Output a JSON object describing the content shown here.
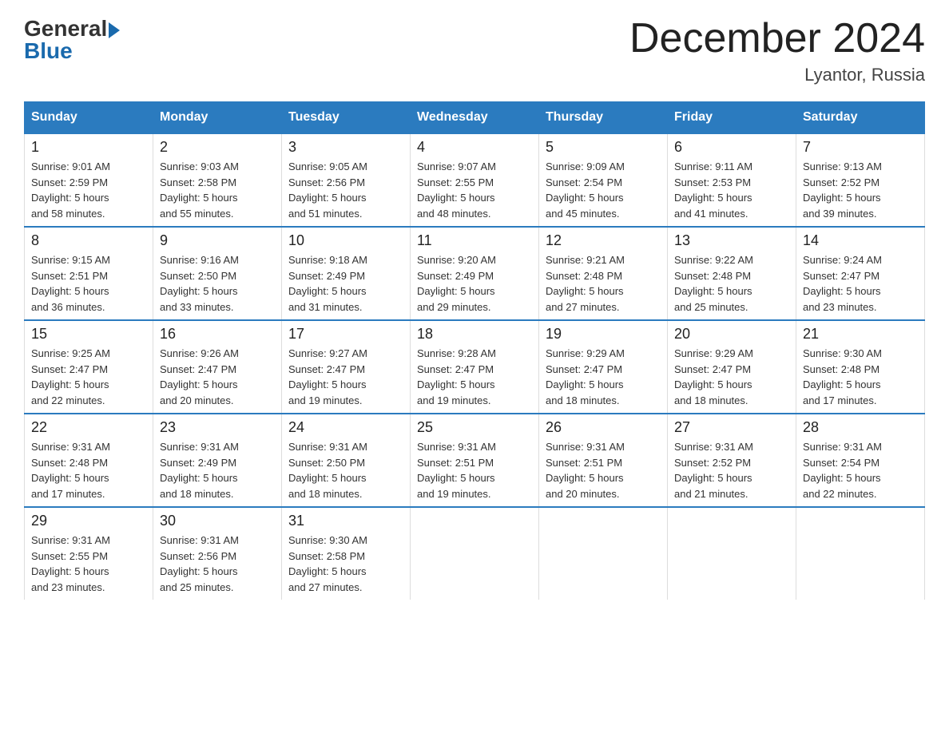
{
  "logo": {
    "general": "General",
    "blue": "Blue"
  },
  "title": "December 2024",
  "location": "Lyantor, Russia",
  "days_of_week": [
    "Sunday",
    "Monday",
    "Tuesday",
    "Wednesday",
    "Thursday",
    "Friday",
    "Saturday"
  ],
  "weeks": [
    [
      {
        "day": "1",
        "sunrise": "Sunrise: 9:01 AM",
        "sunset": "Sunset: 2:59 PM",
        "daylight": "Daylight: 5 hours",
        "daylight2": "and 58 minutes."
      },
      {
        "day": "2",
        "sunrise": "Sunrise: 9:03 AM",
        "sunset": "Sunset: 2:58 PM",
        "daylight": "Daylight: 5 hours",
        "daylight2": "and 55 minutes."
      },
      {
        "day": "3",
        "sunrise": "Sunrise: 9:05 AM",
        "sunset": "Sunset: 2:56 PM",
        "daylight": "Daylight: 5 hours",
        "daylight2": "and 51 minutes."
      },
      {
        "day": "4",
        "sunrise": "Sunrise: 9:07 AM",
        "sunset": "Sunset: 2:55 PM",
        "daylight": "Daylight: 5 hours",
        "daylight2": "and 48 minutes."
      },
      {
        "day": "5",
        "sunrise": "Sunrise: 9:09 AM",
        "sunset": "Sunset: 2:54 PM",
        "daylight": "Daylight: 5 hours",
        "daylight2": "and 45 minutes."
      },
      {
        "day": "6",
        "sunrise": "Sunrise: 9:11 AM",
        "sunset": "Sunset: 2:53 PM",
        "daylight": "Daylight: 5 hours",
        "daylight2": "and 41 minutes."
      },
      {
        "day": "7",
        "sunrise": "Sunrise: 9:13 AM",
        "sunset": "Sunset: 2:52 PM",
        "daylight": "Daylight: 5 hours",
        "daylight2": "and 39 minutes."
      }
    ],
    [
      {
        "day": "8",
        "sunrise": "Sunrise: 9:15 AM",
        "sunset": "Sunset: 2:51 PM",
        "daylight": "Daylight: 5 hours",
        "daylight2": "and 36 minutes."
      },
      {
        "day": "9",
        "sunrise": "Sunrise: 9:16 AM",
        "sunset": "Sunset: 2:50 PM",
        "daylight": "Daylight: 5 hours",
        "daylight2": "and 33 minutes."
      },
      {
        "day": "10",
        "sunrise": "Sunrise: 9:18 AM",
        "sunset": "Sunset: 2:49 PM",
        "daylight": "Daylight: 5 hours",
        "daylight2": "and 31 minutes."
      },
      {
        "day": "11",
        "sunrise": "Sunrise: 9:20 AM",
        "sunset": "Sunset: 2:49 PM",
        "daylight": "Daylight: 5 hours",
        "daylight2": "and 29 minutes."
      },
      {
        "day": "12",
        "sunrise": "Sunrise: 9:21 AM",
        "sunset": "Sunset: 2:48 PM",
        "daylight": "Daylight: 5 hours",
        "daylight2": "and 27 minutes."
      },
      {
        "day": "13",
        "sunrise": "Sunrise: 9:22 AM",
        "sunset": "Sunset: 2:48 PM",
        "daylight": "Daylight: 5 hours",
        "daylight2": "and 25 minutes."
      },
      {
        "day": "14",
        "sunrise": "Sunrise: 9:24 AM",
        "sunset": "Sunset: 2:47 PM",
        "daylight": "Daylight: 5 hours",
        "daylight2": "and 23 minutes."
      }
    ],
    [
      {
        "day": "15",
        "sunrise": "Sunrise: 9:25 AM",
        "sunset": "Sunset: 2:47 PM",
        "daylight": "Daylight: 5 hours",
        "daylight2": "and 22 minutes."
      },
      {
        "day": "16",
        "sunrise": "Sunrise: 9:26 AM",
        "sunset": "Sunset: 2:47 PM",
        "daylight": "Daylight: 5 hours",
        "daylight2": "and 20 minutes."
      },
      {
        "day": "17",
        "sunrise": "Sunrise: 9:27 AM",
        "sunset": "Sunset: 2:47 PM",
        "daylight": "Daylight: 5 hours",
        "daylight2": "and 19 minutes."
      },
      {
        "day": "18",
        "sunrise": "Sunrise: 9:28 AM",
        "sunset": "Sunset: 2:47 PM",
        "daylight": "Daylight: 5 hours",
        "daylight2": "and 19 minutes."
      },
      {
        "day": "19",
        "sunrise": "Sunrise: 9:29 AM",
        "sunset": "Sunset: 2:47 PM",
        "daylight": "Daylight: 5 hours",
        "daylight2": "and 18 minutes."
      },
      {
        "day": "20",
        "sunrise": "Sunrise: 9:29 AM",
        "sunset": "Sunset: 2:47 PM",
        "daylight": "Daylight: 5 hours",
        "daylight2": "and 18 minutes."
      },
      {
        "day": "21",
        "sunrise": "Sunrise: 9:30 AM",
        "sunset": "Sunset: 2:48 PM",
        "daylight": "Daylight: 5 hours",
        "daylight2": "and 17 minutes."
      }
    ],
    [
      {
        "day": "22",
        "sunrise": "Sunrise: 9:31 AM",
        "sunset": "Sunset: 2:48 PM",
        "daylight": "Daylight: 5 hours",
        "daylight2": "and 17 minutes."
      },
      {
        "day": "23",
        "sunrise": "Sunrise: 9:31 AM",
        "sunset": "Sunset: 2:49 PM",
        "daylight": "Daylight: 5 hours",
        "daylight2": "and 18 minutes."
      },
      {
        "day": "24",
        "sunrise": "Sunrise: 9:31 AM",
        "sunset": "Sunset: 2:50 PM",
        "daylight": "Daylight: 5 hours",
        "daylight2": "and 18 minutes."
      },
      {
        "day": "25",
        "sunrise": "Sunrise: 9:31 AM",
        "sunset": "Sunset: 2:51 PM",
        "daylight": "Daylight: 5 hours",
        "daylight2": "and 19 minutes."
      },
      {
        "day": "26",
        "sunrise": "Sunrise: 9:31 AM",
        "sunset": "Sunset: 2:51 PM",
        "daylight": "Daylight: 5 hours",
        "daylight2": "and 20 minutes."
      },
      {
        "day": "27",
        "sunrise": "Sunrise: 9:31 AM",
        "sunset": "Sunset: 2:52 PM",
        "daylight": "Daylight: 5 hours",
        "daylight2": "and 21 minutes."
      },
      {
        "day": "28",
        "sunrise": "Sunrise: 9:31 AM",
        "sunset": "Sunset: 2:54 PM",
        "daylight": "Daylight: 5 hours",
        "daylight2": "and 22 minutes."
      }
    ],
    [
      {
        "day": "29",
        "sunrise": "Sunrise: 9:31 AM",
        "sunset": "Sunset: 2:55 PM",
        "daylight": "Daylight: 5 hours",
        "daylight2": "and 23 minutes."
      },
      {
        "day": "30",
        "sunrise": "Sunrise: 9:31 AM",
        "sunset": "Sunset: 2:56 PM",
        "daylight": "Daylight: 5 hours",
        "daylight2": "and 25 minutes."
      },
      {
        "day": "31",
        "sunrise": "Sunrise: 9:30 AM",
        "sunset": "Sunset: 2:58 PM",
        "daylight": "Daylight: 5 hours",
        "daylight2": "and 27 minutes."
      },
      null,
      null,
      null,
      null
    ]
  ]
}
